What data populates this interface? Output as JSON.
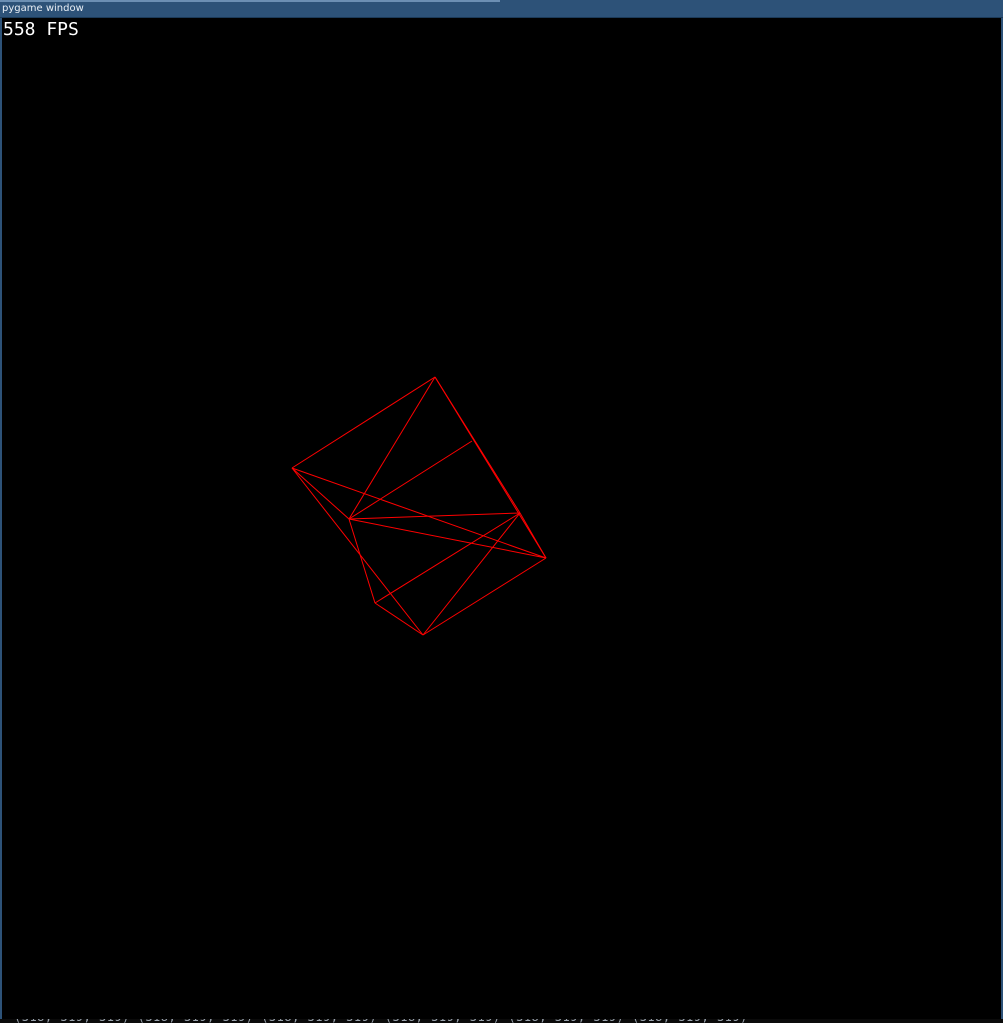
{
  "window": {
    "title": "pygame window"
  },
  "hud": {
    "fps_value": 558,
    "fps_label": "558 FPS"
  },
  "colors": {
    "titlebar": "#2d5278",
    "background": "#000000",
    "wireframe": "#ff0000",
    "hud_text": "#ffffff"
  },
  "scene": {
    "object": "wireframe-cube",
    "line_color": "#ff0000"
  }
}
